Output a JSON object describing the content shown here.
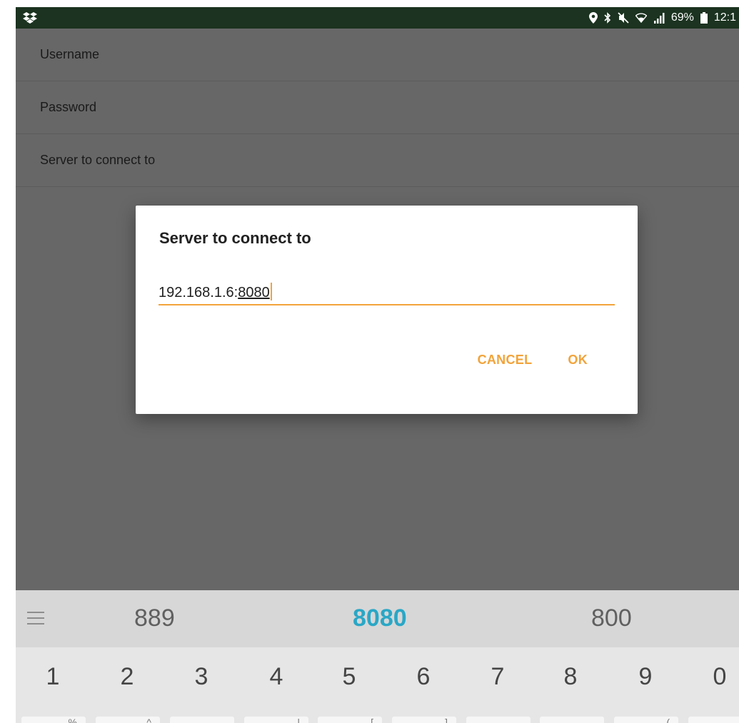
{
  "status_bar": {
    "battery_percent": "69%",
    "time": "12:1",
    "icons": [
      "dropbox-icon",
      "location-icon",
      "bluetooth-icon",
      "mute-icon",
      "wifi-icon",
      "signal-icon",
      "battery-icon"
    ]
  },
  "preferences": {
    "items": [
      {
        "label": "Username"
      },
      {
        "label": "Password"
      },
      {
        "label": "Server to connect to"
      }
    ]
  },
  "dialog": {
    "title": "Server to connect to",
    "input_value_prefix": "192.168.1.6:",
    "input_value_composing": "8080",
    "cancel_label": "CANCEL",
    "ok_label": "OK"
  },
  "keyboard": {
    "suggestions": [
      "889",
      "8080",
      "800"
    ],
    "number_row": [
      "1",
      "2",
      "3",
      "4",
      "5",
      "6",
      "7",
      "8",
      "9",
      "0"
    ],
    "symbol_hints": [
      "%",
      "^",
      "",
      "|",
      "[",
      "]",
      "",
      "",
      "(",
      ""
    ]
  },
  "colors": {
    "accent": "#f2a33a",
    "status_bar": "#1b3320",
    "suggestion_highlight": "#2aa7c6"
  }
}
